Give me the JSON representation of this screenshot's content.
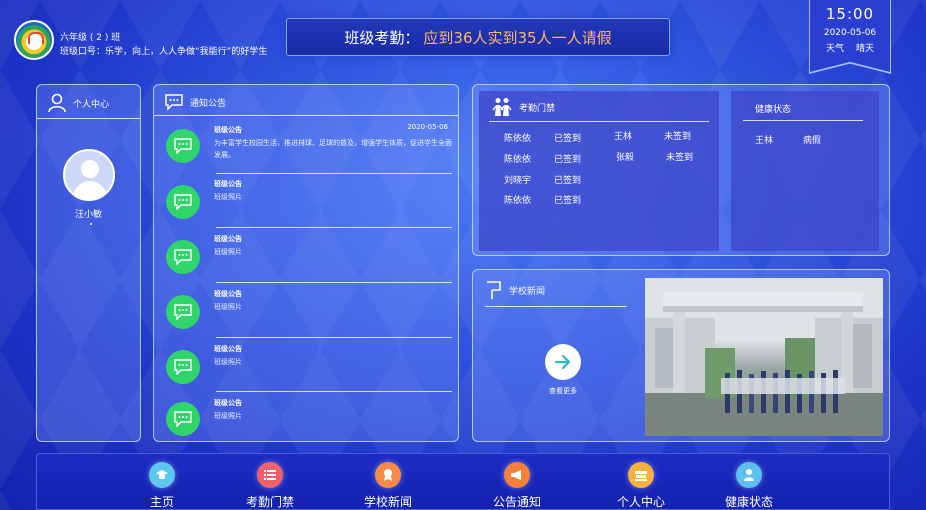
{
  "header": {
    "class_name": "六年级 ( 2 ) 班",
    "slogan": "班级口号：乐学，向上，人人争做“我能行”的好学生",
    "banner_prefix": "班级考勤：",
    "banner_highlight": "应到36人实到35人一人请假"
  },
  "clock": {
    "time": "15:00",
    "date": "2020-05-06",
    "weather_label": "天气",
    "weather_value": "晴天"
  },
  "personal": {
    "title": "个人中心",
    "name": "汪小敏"
  },
  "notices": {
    "title": "通知公告",
    "items": [
      {
        "title": "班级公告",
        "date": "2020-05-06",
        "text": "为丰富学生校园生活，推进排球、足球的普及，增强学生体质，促进学生全面发展。"
      },
      {
        "title": "班级公告",
        "text": "班级照片"
      },
      {
        "title": "班级公告",
        "text": "班级照片"
      },
      {
        "title": "班级公告",
        "text": "班级照片"
      },
      {
        "title": "班级公告",
        "text": "班级照片"
      },
      {
        "title": "班级公告",
        "text": "班级照片"
      }
    ]
  },
  "attendance": {
    "title": "考勤门禁",
    "rows": [
      {
        "name": "陈依依",
        "status": "已签到"
      },
      {
        "name": "陈依依",
        "status": "已签到"
      },
      {
        "name": "刘晓宇",
        "status": "已签到"
      },
      {
        "name": "陈依依",
        "status": "已签到"
      },
      {
        "name": "王林",
        "status": "未签到"
      },
      {
        "name": "张毅",
        "status": "未签到"
      }
    ]
  },
  "health": {
    "title": "健康状态",
    "rows": [
      {
        "name": "王林",
        "status": "病假"
      }
    ]
  },
  "news": {
    "title": "学校新闻",
    "more_label": "查看更多"
  },
  "nav": {
    "items": [
      {
        "label": "主页",
        "color": "#5cc8f0"
      },
      {
        "label": "考勤门禁",
        "color": "#f0606a"
      },
      {
        "label": "学校新闻",
        "color": "#f58a4a"
      },
      {
        "label": "公告通知",
        "color": "#f5803a"
      },
      {
        "label": "个人中心",
        "color": "#f5b13a"
      },
      {
        "label": "健康状态",
        "color": "#5cc0f0"
      }
    ]
  }
}
